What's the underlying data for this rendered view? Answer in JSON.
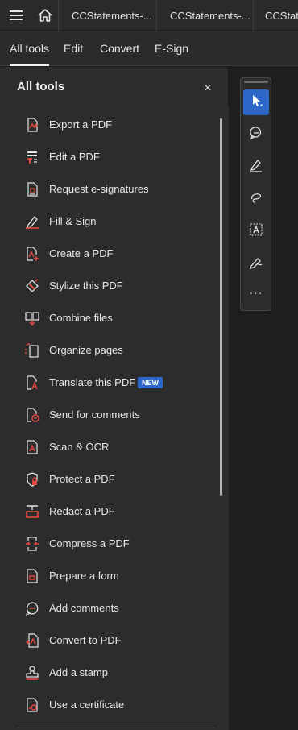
{
  "titlebar": {
    "tabs": [
      {
        "label": "CCStatements-..."
      },
      {
        "label": "CCStatements-..."
      },
      {
        "label": "CCStatem"
      }
    ]
  },
  "modebar": {
    "tabs": [
      {
        "label": "All tools",
        "active": true
      },
      {
        "label": "Edit"
      },
      {
        "label": "Convert"
      },
      {
        "label": "E-Sign"
      }
    ]
  },
  "panel": {
    "title": "All tools",
    "close_glyph": "×",
    "tools": [
      {
        "label": "Export a PDF",
        "icon": "export-pdf-icon"
      },
      {
        "label": "Edit a PDF",
        "icon": "edit-pdf-icon"
      },
      {
        "label": "Request e-signatures",
        "icon": "request-esign-icon"
      },
      {
        "label": "Fill & Sign",
        "icon": "fill-sign-icon"
      },
      {
        "label": "Create a PDF",
        "icon": "create-pdf-icon"
      },
      {
        "label": "Stylize this PDF",
        "icon": "stylize-icon"
      },
      {
        "label": "Combine files",
        "icon": "combine-icon"
      },
      {
        "label": "Organize pages",
        "icon": "organize-icon"
      },
      {
        "label": "Translate this PDF",
        "icon": "translate-icon",
        "badge": "NEW"
      },
      {
        "label": "Send for comments",
        "icon": "send-comments-icon"
      },
      {
        "label": "Scan & OCR",
        "icon": "scan-ocr-icon"
      },
      {
        "label": "Protect a PDF",
        "icon": "protect-icon"
      },
      {
        "label": "Redact a PDF",
        "icon": "redact-icon"
      },
      {
        "label": "Compress a PDF",
        "icon": "compress-icon"
      },
      {
        "label": "Prepare a form",
        "icon": "form-icon"
      },
      {
        "label": "Add comments",
        "icon": "comment-icon"
      },
      {
        "label": "Convert to PDF",
        "icon": "convert-icon"
      },
      {
        "label": "Add a stamp",
        "icon": "stamp-icon"
      },
      {
        "label": "Use a certificate",
        "icon": "certificate-icon"
      }
    ]
  },
  "quick_tools": {
    "items": [
      {
        "icon": "select-cursor-icon",
        "active": true
      },
      {
        "icon": "comment-bubble-icon"
      },
      {
        "icon": "highlighter-icon"
      },
      {
        "icon": "draw-lasso-icon"
      },
      {
        "icon": "text-select-icon"
      },
      {
        "icon": "sign-pen-icon"
      }
    ],
    "more_glyph": "···"
  },
  "colors": {
    "accent_red": "#e3473f",
    "badge_blue": "#2d67c8",
    "panel_bg": "#2c2c2c"
  }
}
